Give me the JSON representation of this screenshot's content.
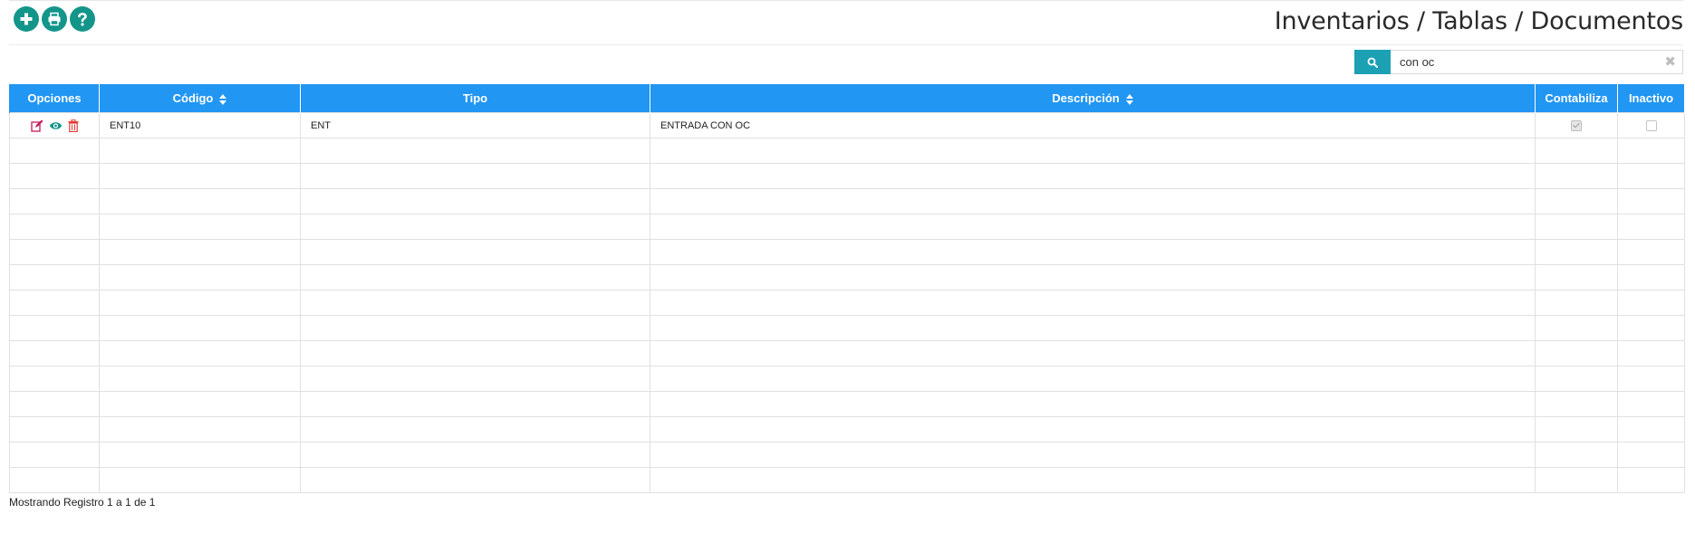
{
  "toolbar": {
    "add_icon": "plus-circle-icon",
    "print_icon": "print-icon",
    "help_icon": "question-icon",
    "accent_color": "#14958a"
  },
  "page": {
    "title": "Inventarios / Tablas / Documentos"
  },
  "search": {
    "value": "con oc",
    "button_color": "#1ca0b4",
    "clear_label": "✖"
  },
  "table": {
    "header_color": "#2196f3",
    "columns": [
      "Opciones",
      "Código",
      "Tipo",
      "Descripción",
      "Contabiliza",
      "Inactivo"
    ],
    "rows": [
      {
        "codigo": "ENT10",
        "tipo": "ENT",
        "descripcion": "ENTRADA CON OC",
        "contabiliza": true,
        "inactivo": false
      }
    ]
  },
  "footer": {
    "info": "Mostrando Registro 1 a 1 de 1"
  }
}
